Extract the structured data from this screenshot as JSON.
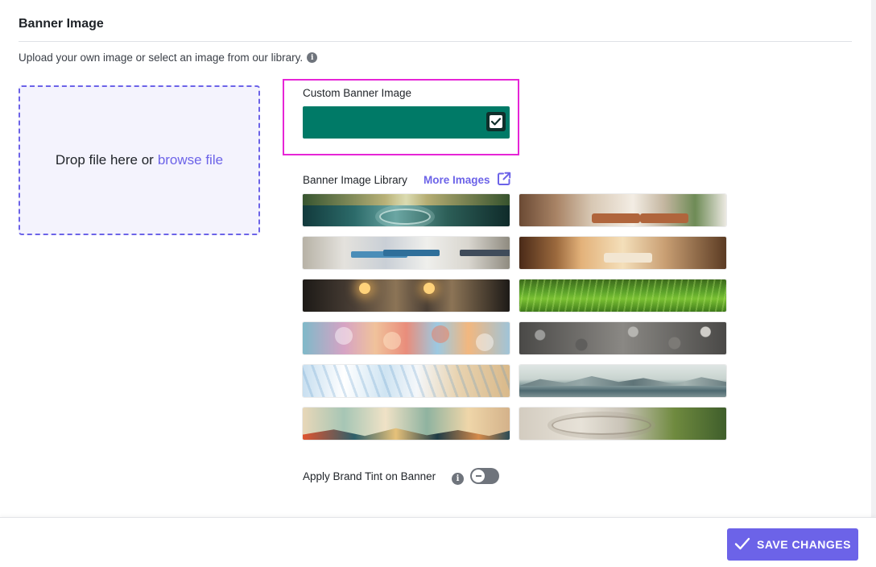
{
  "section": {
    "title": "Banner Image",
    "subtitle": "Upload your own image or select an image from our library."
  },
  "dropzone": {
    "text": "Drop file here or",
    "link": "browse file"
  },
  "custom_banner": {
    "label": "Custom Banner Image",
    "color": "#007a67",
    "checked": true
  },
  "library": {
    "label": "Banner Image Library",
    "more_link": "More Images",
    "images": [
      {
        "name": "lake-ripples"
      },
      {
        "name": "living-room"
      },
      {
        "name": "clinic-room"
      },
      {
        "name": "spa-room"
      },
      {
        "name": "tea-cups"
      },
      {
        "name": "grass"
      },
      {
        "name": "bokeh"
      },
      {
        "name": "pebbles"
      },
      {
        "name": "ocean-waves"
      },
      {
        "name": "misty-mountains"
      },
      {
        "name": "abstract-landscape"
      },
      {
        "name": "zen-garden"
      }
    ]
  },
  "tint": {
    "label": "Apply Brand Tint on Banner",
    "enabled": false
  },
  "footer": {
    "save_label": "SAVE CHANGES"
  },
  "colors": {
    "accent": "#6c63e8",
    "highlight": "#e625d6",
    "custom_color": "#007a67"
  }
}
